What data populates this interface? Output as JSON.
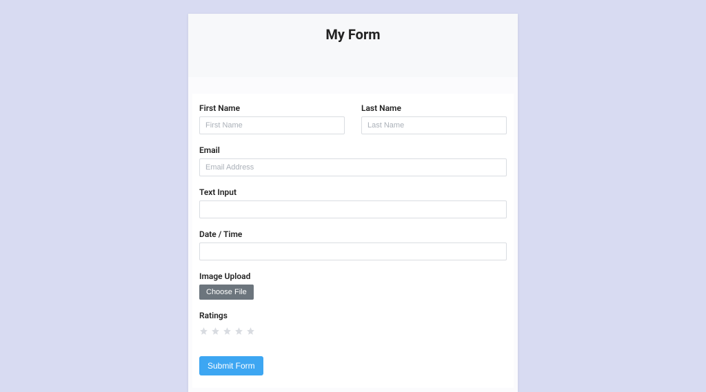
{
  "header": {
    "title": "My Form"
  },
  "fields": {
    "first_name": {
      "label": "First Name",
      "placeholder": "First Name"
    },
    "last_name": {
      "label": "Last Name",
      "placeholder": "Last Name"
    },
    "email": {
      "label": "Email",
      "placeholder": "Email Address"
    },
    "text_input": {
      "label": "Text Input"
    },
    "date_time": {
      "label": "Date / Time"
    },
    "image_upload": {
      "label": "Image Upload",
      "button": "Choose File"
    },
    "ratings": {
      "label": "Ratings"
    }
  },
  "submit": {
    "label": "Submit Form"
  }
}
